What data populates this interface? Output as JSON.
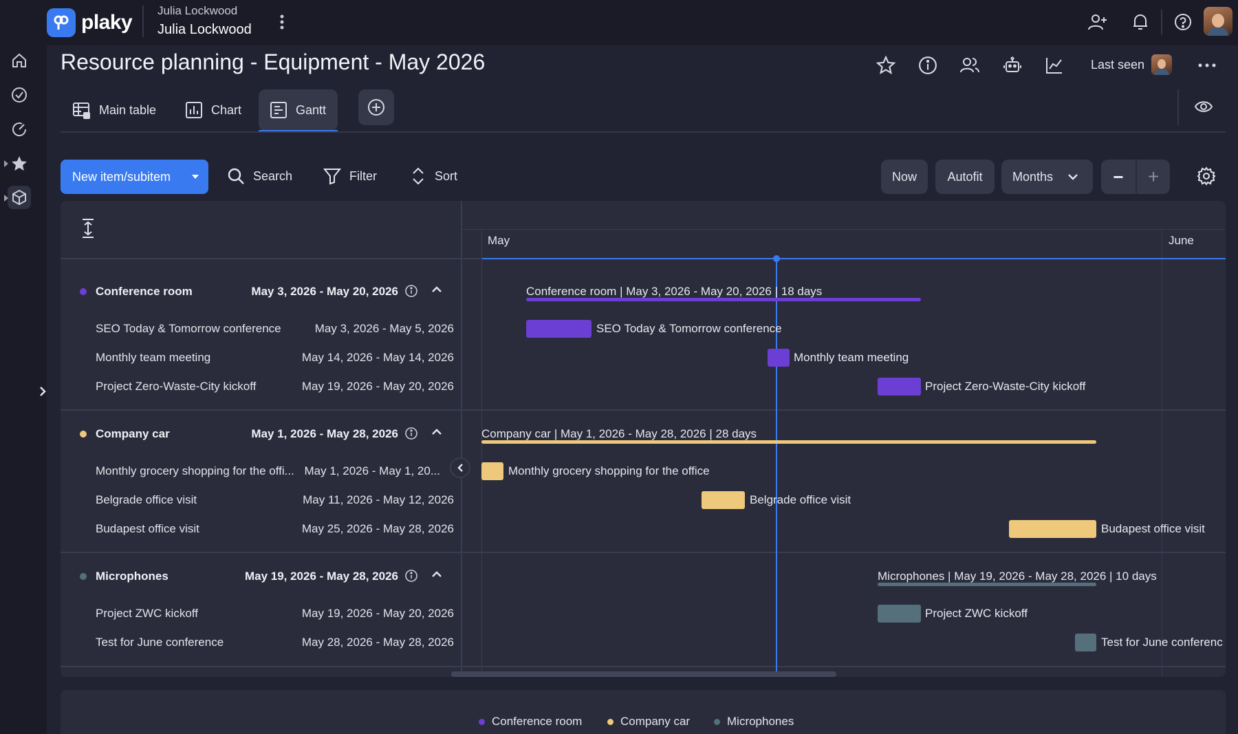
{
  "app": {
    "brand": "plaky"
  },
  "user": {
    "name_small": "Julia Lockwood",
    "name_large": "Julia Lockwood"
  },
  "board": {
    "title": "Resource planning - Equipment - May 2026",
    "last_seen_label": "Last seen"
  },
  "tabs": [
    {
      "label": "Main table",
      "icon": "table-icon",
      "active": false
    },
    {
      "label": "Chart",
      "icon": "chart-icon",
      "active": false
    },
    {
      "label": "Gantt",
      "icon": "gantt-icon",
      "active": true
    }
  ],
  "toolbar": {
    "new_item_label": "New item/subitem",
    "search_label": "Search",
    "filter_label": "Filter",
    "sort_label": "Sort",
    "now_label": "Now",
    "autofit_label": "Autofit",
    "scale_label": "Months",
    "zoom_out": "−",
    "zoom_in": "+"
  },
  "timeline": {
    "months": [
      "May",
      "June"
    ]
  },
  "groups": [
    {
      "name": "Conference room",
      "range": "May 3, 2026 - May 20, 2026",
      "color": "#6b3fd4",
      "summary": "Conference room | May 3, 2026 - May 20, 2026 | 18 days",
      "items": [
        {
          "name": "SEO Today & Tomorrow conference",
          "range": "May 3, 2026 - May 5, 2026",
          "bar_label": "SEO Today & Tomorrow conference"
        },
        {
          "name": "Monthly team meeting",
          "range": "May 14, 2026 - May 14, 2026",
          "bar_label": "Monthly team meeting"
        },
        {
          "name": "Project Zero-Waste-City kickoff",
          "range": "May 19, 2026 - May 20, 2026",
          "bar_label": "Project Zero-Waste-City kickoff"
        }
      ]
    },
    {
      "name": "Company car",
      "range": "May 1, 2026 - May 28, 2026",
      "color": "#efc97b",
      "summary": "Company car | May 1, 2026 - May 28, 2026 | 28 days",
      "items": [
        {
          "name": "Monthly grocery shopping for the offi...",
          "range": "May 1, 2026 - May 1, 20...",
          "bar_label": "Monthly grocery shopping for the office"
        },
        {
          "name": "Belgrade office visit",
          "range": "May 11, 2026 - May 12, 2026",
          "bar_label": "Belgrade office visit"
        },
        {
          "name": "Budapest office visit",
          "range": "May 25, 2026 - May 28, 2026",
          "bar_label": "Budapest office visit"
        }
      ]
    },
    {
      "name": "Microphones",
      "range": "May 19, 2026 - May 28, 2026",
      "color": "#55707a",
      "summary": "Microphones | May 19, 2026 - May 28, 2026 | 10 days",
      "items": [
        {
          "name": "Project ZWC kickoff",
          "range": "May 19, 2026 - May 20, 2026",
          "bar_label": "Project ZWC kickoff"
        },
        {
          "name": "Test for June conference",
          "range": "May 28, 2026 - May 28, 2026",
          "bar_label": "Test for June conferenc"
        }
      ]
    }
  ],
  "legend": [
    "Conference room",
    "Company car",
    "Microphones"
  ]
}
